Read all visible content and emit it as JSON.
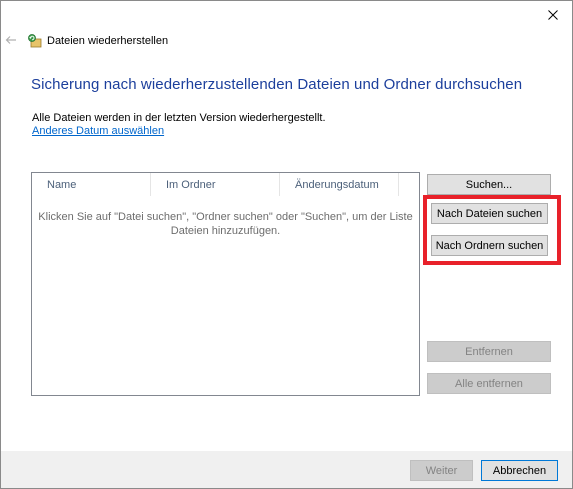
{
  "window": {
    "title": "Dateien wiederherstellen",
    "close_icon": "close-icon",
    "back_icon": "back-arrow-icon",
    "app_icon": "restore-files-icon"
  },
  "main": {
    "heading": "Sicherung nach wiederherzustellenden Dateien und Ordner durchsuchen",
    "info_text": "Alle Dateien werden in der letzten Version wiederhergestellt.",
    "date_link": "Anderes Datum auswählen"
  },
  "file_list": {
    "columns": [
      "Name",
      "Im Ordner",
      "Änderungsdatum"
    ],
    "empty_hint_line1": "Klicken Sie auf \"Datei suchen\", \"Ordner suchen\" oder \"Suchen\", um der Liste",
    "empty_hint_line2": "Dateien hinzuzufügen."
  },
  "side_buttons": {
    "search": "Suchen...",
    "search_files": "Nach Dateien suchen",
    "search_folders": "Nach Ordnern suchen",
    "remove": "Entfernen",
    "remove_all": "Alle entfernen"
  },
  "footer": {
    "next": "Weiter",
    "cancel": "Abbrechen"
  },
  "colors": {
    "heading": "#1c3f9c",
    "link": "#0066cc",
    "highlight": "#e8212a"
  }
}
